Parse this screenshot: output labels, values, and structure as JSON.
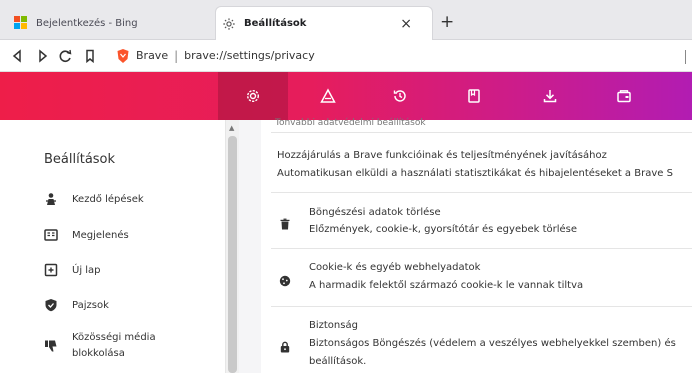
{
  "browser": {
    "tabs": [
      {
        "title": "Bejelentkezés - Bing",
        "icon": "microsoft-icon",
        "active": false
      },
      {
        "title": "Beállítások",
        "icon": "gear-icon",
        "active": true
      }
    ],
    "tab_close_glyph": "×",
    "new_tab_glyph": "+",
    "address": {
      "brand": "Brave",
      "separator": "|",
      "url": "brave://settings/privacy"
    }
  },
  "header": {
    "icons": [
      "gear-icon",
      "brave-rewards-icon",
      "history-icon",
      "bookmarks-icon",
      "downloads-icon",
      "wallet-icon"
    ],
    "selected": "gear-icon",
    "colors": {
      "start": "#ee1e49",
      "end": "#b21cb2"
    }
  },
  "sidebar": {
    "title": "Beállítások",
    "items": [
      {
        "label": "Kezdő lépések",
        "icon": "rocket-person-icon"
      },
      {
        "label": "Megjelenés",
        "icon": "appearance-icon"
      },
      {
        "label": "Új lap",
        "icon": "new-tab-icon"
      },
      {
        "label": "Pajzsok",
        "icon": "shield-icon"
      },
      {
        "label_line1": "Közösségi média",
        "label_line2": "blokkolása",
        "icon": "thumbs-down-icon"
      }
    ]
  },
  "content": {
    "cut_heading": "Tonvabbi adatvédelmi beállítások",
    "desc_line1": "Hozzájárulás a Brave funkcióinak és teljesítményének javításához",
    "desc_line2": "Automatikusan elküldi a használati statisztikákat és hibajelentéseket a Brave S",
    "rows": [
      {
        "title": "Böngészési adatok törlése",
        "subtitle": "Előzmények, cookie-k, gyorsítótár és egyebek törlése",
        "icon": "trash-icon"
      },
      {
        "title": "Cookie-k és egyéb webhelyadatok",
        "subtitle": "A harmadik felektől származó cookie-k le vannak tiltva",
        "icon": "cookie-icon"
      },
      {
        "title": "Biztonság",
        "subtitle": "Biztonságos Böngészés (védelem a veszélyes webhelyekkel szemben) és",
        "subtitle2": "beállítások.",
        "icon": "lock-icon"
      }
    ]
  }
}
